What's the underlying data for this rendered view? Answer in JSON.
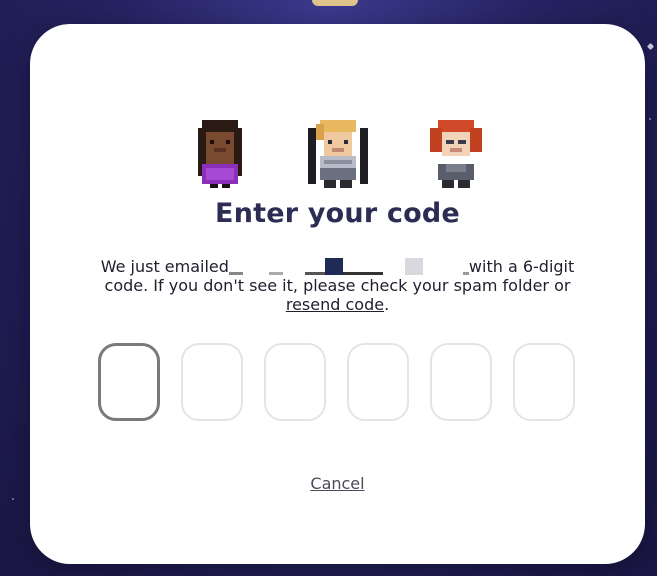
{
  "dialog": {
    "title": "Enter your code",
    "description": {
      "prefix": "We just emailed",
      "redacted_email_icon": "redacted-email",
      "suffix": "with a 6-digit code. If you don't see it, please check your spam folder or",
      "resend_link": "resend code",
      "end": "."
    },
    "code_inputs": [
      {
        "value": "",
        "focused": true
      },
      {
        "value": "",
        "focused": false
      },
      {
        "value": "",
        "focused": false
      },
      {
        "value": "",
        "focused": false
      },
      {
        "value": "",
        "focused": false
      },
      {
        "value": "",
        "focused": false
      }
    ],
    "cancel_label": "Cancel",
    "avatars": [
      "pixel-character-purple-dress",
      "pixel-character-blonde-armor",
      "pixel-character-red-hair"
    ]
  },
  "colors": {
    "title": "#2c2c54",
    "box_border": "#e4e4e8",
    "box_border_active": "#7a7a7a",
    "background": "#262363"
  }
}
